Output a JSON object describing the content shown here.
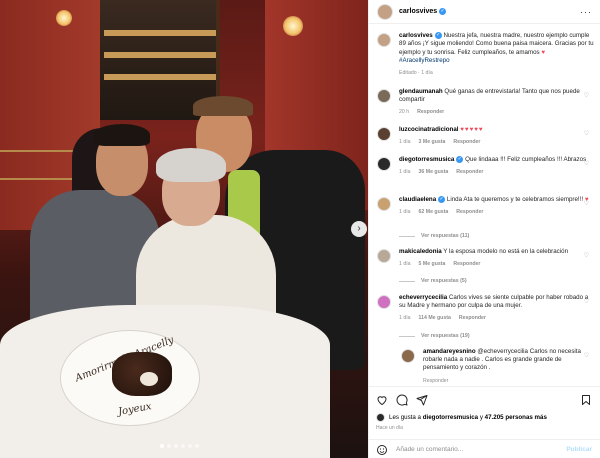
{
  "post": {
    "username": "carlosvives",
    "caption_text": "Nuestra jefa, nuestra madre, nuestro ejemplo cumple 89 años ¡Y sigue moliendo! Como buena paisa maicera. Gracias por tu ejemplo y tu sonrisa. Feliz cumpleaños, te amamos",
    "caption_hashtag": "#AracellyRestrepo",
    "caption_meta": "Editado · 1 día",
    "photo_plate_text_1": "Amorirm de Aracelly",
    "photo_plate_text_2": "Joyeux",
    "carousel": {
      "dots": 6,
      "active": 0
    }
  },
  "comments": [
    {
      "user": "glendaumanah",
      "text": "Qué ganas de entrevistarla! Tanto que nos puede compartir",
      "time": "20 h",
      "likes": "",
      "reply": "Responder",
      "verified": false
    },
    {
      "user": "luzcocinatradicional",
      "text": "♥♥♥♥♥",
      "time": "1 día",
      "likes": "3 Me gusta",
      "reply": "Responder",
      "verified": false,
      "hearts": true
    },
    {
      "user": "diegotorresmusica",
      "text": "Que lindaaa !!! Feliz cumpleaños !!! Abrazos",
      "time": "1 día",
      "likes": "36 Me gusta",
      "reply": "Responder",
      "verified": true
    },
    {
      "user": "claudiaelena",
      "text": "Linda Ata te queremos y te celebramos siempre!!!",
      "time": "1 día",
      "likes": "62 Me gusta",
      "reply": "Responder",
      "verified": true,
      "replies": "Ver respuestas (11)"
    },
    {
      "user": "makicaledonia",
      "text": "Y la esposa modelo no está en la celebración",
      "time": "1 día",
      "likes": "5 Me gusta",
      "reply": "Responder",
      "verified": false,
      "replies": "Ver respuestas (5)"
    },
    {
      "user": "echeverrycecilia",
      "text": "Carlos vives se siente culpable por haber robado a su Madre y hermano por culpa de una mujer.",
      "time": "1 día",
      "likes": "114 Me gusta",
      "reply": "Responder",
      "verified": false,
      "replies": "Ver respuestas (19)"
    },
    {
      "user": "amandareyesnino",
      "text": "@echeverrycecilia Carlos no necesita robarle nada a nadie . Carlos es grande grande de pensamiento y corazón .",
      "time": "",
      "likes": "",
      "reply": "Responder",
      "verified": false
    }
  ],
  "actions": {
    "likes_prefix": "Les gusta a",
    "liked_user": "diegotorresmusica",
    "likes_join": "y",
    "likes_count": "47.205 personas más",
    "time": "Hace un día",
    "comment_placeholder": "Añade un comentario...",
    "publish_label": "Publicar"
  },
  "colors": {
    "accent": "#3897f0",
    "heart": "#ed4956",
    "muted": "#8e8e8e"
  }
}
